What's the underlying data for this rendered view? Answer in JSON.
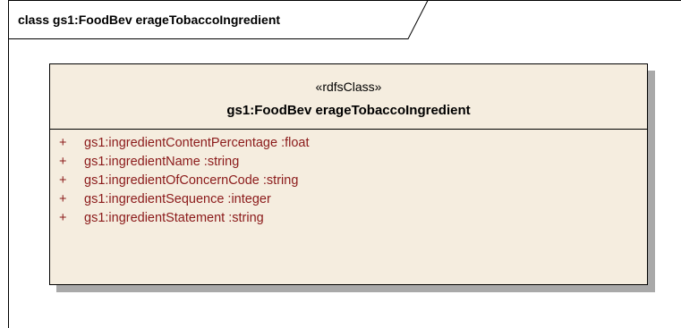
{
  "frame": {
    "title": "class gs1:FoodBev erageTobaccoIngredient"
  },
  "class_box": {
    "stereotype": "«rdfsClass»",
    "name": "gs1:FoodBev erageTobaccoIngredient",
    "fill_color": "#f5eddf",
    "attribute_color": "#8b1a1a",
    "attributes": [
      {
        "visibility": "+",
        "text": "gs1:ingredientContentPercentage  :float"
      },
      {
        "visibility": "+",
        "text": "gs1:ingredientName  :string"
      },
      {
        "visibility": "+",
        "text": "gs1:ingredientOfConcernCode  :string"
      },
      {
        "visibility": "+",
        "text": "gs1:ingredientSequence  :integer"
      },
      {
        "visibility": "+",
        "text": "gs1:ingredientStatement  :string"
      }
    ]
  }
}
